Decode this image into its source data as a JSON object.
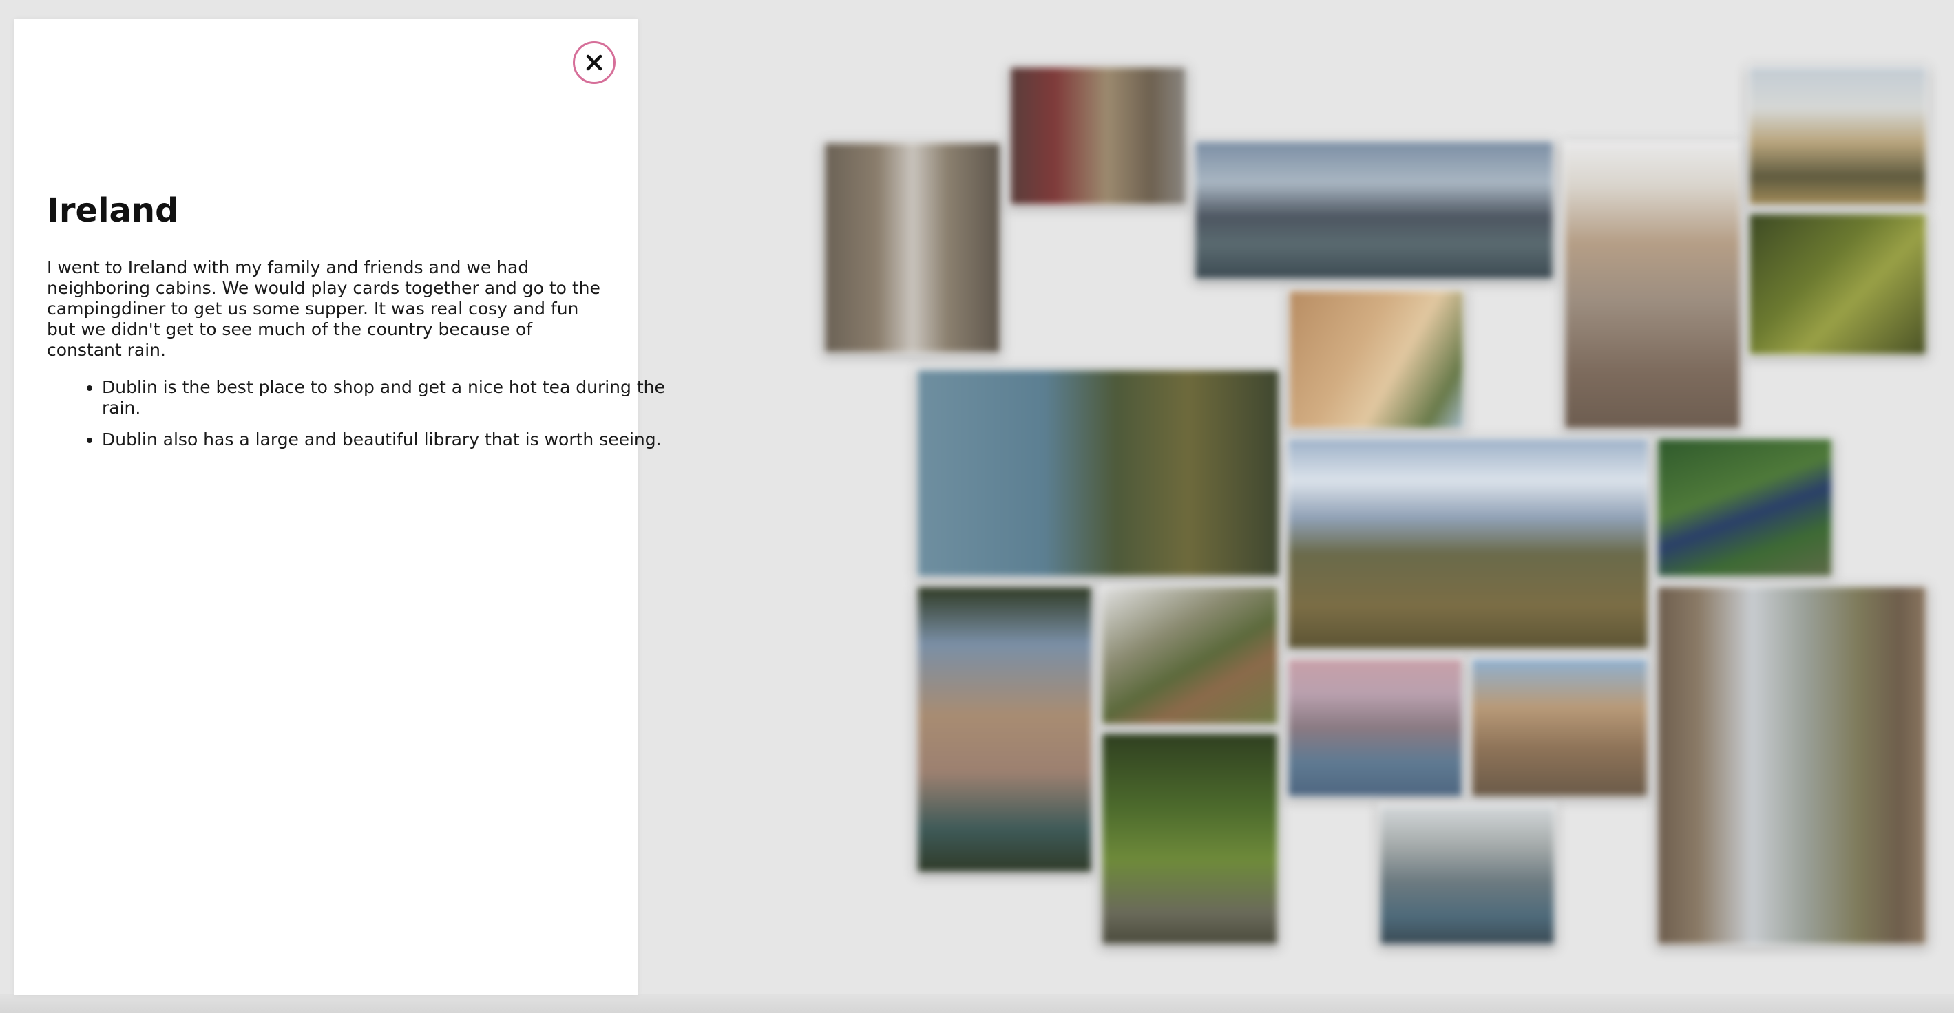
{
  "panel": {
    "close_icon": "close-icon",
    "title": "Ireland",
    "description": "I went to Ireland with my family and friends and we had neighboring cabins. We would play cards together and go to the campingdiner to get us some supper. It was real cosy and fun but we didn't get to see much of the country because of constant rain.",
    "bullets": [
      "Dublin is the best place to shop and get a nice hot tea during the rain.",
      "Dublin also has a large and beautiful library that is worth seeing."
    ]
  },
  "colors": {
    "close_ring": "#d66f99",
    "background": "#e6e6e6"
  }
}
